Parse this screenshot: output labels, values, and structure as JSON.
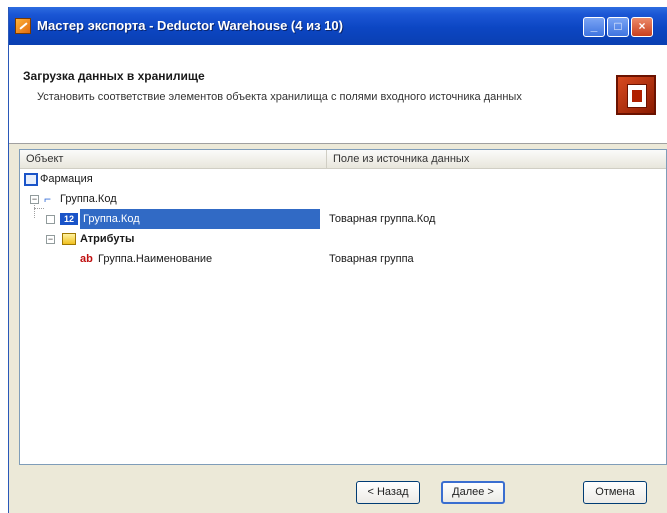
{
  "window": {
    "title": "Мастер экспорта - Deductor Warehouse (4 из 10)"
  },
  "header": {
    "title": "Загрузка данных в хранилище",
    "description": "Установить соответствие элементов объекта хранилища с полями входного источника данных"
  },
  "table": {
    "columns": [
      "Объект",
      "Поле из источника данных"
    ],
    "rows": [
      {
        "object": "Фармация",
        "field": "",
        "icon": "cube-icon",
        "expander": ""
      },
      {
        "object": "Группа.Код",
        "field": "",
        "icon": "dimension-icon",
        "expander": "−"
      },
      {
        "object": "Группа.Код",
        "field": "Товарная группа.Код",
        "icon": "key-badge-icon",
        "badge": "12",
        "expander": "",
        "selected": true
      },
      {
        "object": "Атрибуты",
        "field": "",
        "icon": "folder-icon",
        "expander": "−"
      },
      {
        "object": "Группа.Наименование",
        "field": "Товарная группа",
        "icon": "string-icon",
        "icon_text": "ab",
        "expander": ""
      }
    ]
  },
  "buttons": {
    "back": "< Назад",
    "next": "Далее >",
    "cancel": "Отмена"
  },
  "colors": {
    "titlebar": "#0c46c3",
    "selection": "#316ac5",
    "dialog_bg": "#ece9d8"
  }
}
